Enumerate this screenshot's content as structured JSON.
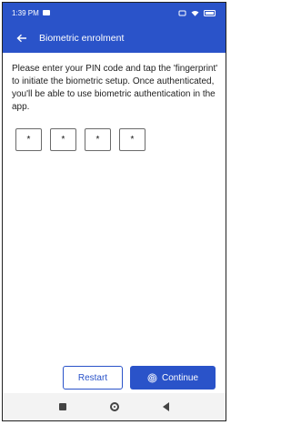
{
  "status_bar": {
    "time": "1:39 PM",
    "battery": ""
  },
  "app_bar": {
    "title": "Biometric enrolment"
  },
  "content": {
    "instructions": "Please enter your PIN code and tap the 'fingerprint' to initiate the biometric setup. Once authenticated, you'll be able to use biometric authentication in the app.",
    "pin_digits": [
      "*",
      "*",
      "*",
      "*"
    ]
  },
  "buttons": {
    "restart_label": "Restart",
    "continue_label": "Continue"
  },
  "colors": {
    "primary": "#2a53c9"
  }
}
